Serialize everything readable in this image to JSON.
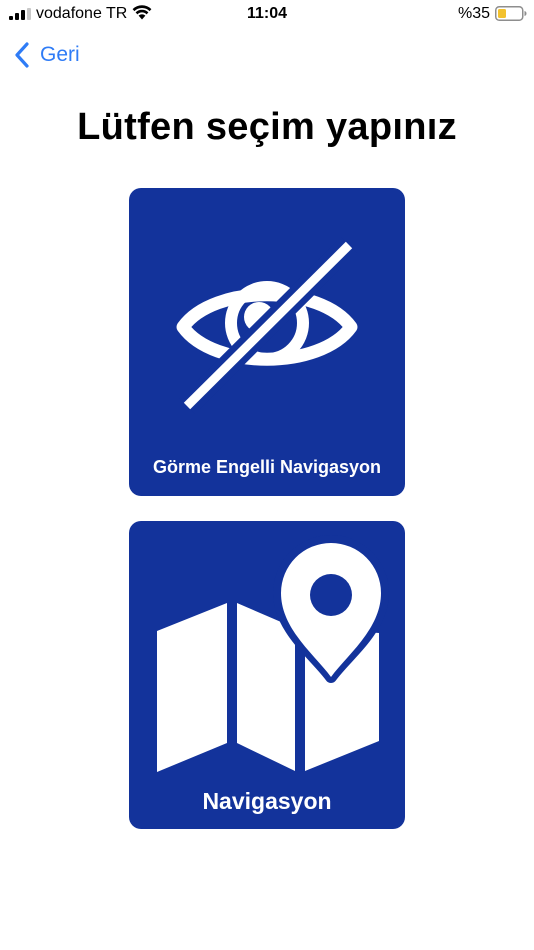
{
  "status_bar": {
    "carrier": "vodafone TR",
    "time": "11:04",
    "battery_percent": "%35",
    "battery_level": 0.35,
    "icons": [
      "signal-icon",
      "wifi-icon",
      "battery-icon"
    ]
  },
  "nav": {
    "back_label": "Geri",
    "back_icon": "chevron-left-icon"
  },
  "page": {
    "title": "Lütfen seçim yapınız"
  },
  "options": [
    {
      "label": "Görme Engelli Navigasyon",
      "icon": "eye-slash-icon"
    },
    {
      "label": "Navigasyon",
      "icon": "map-pin-icon"
    }
  ],
  "colors": {
    "accent": "#2f7cf6",
    "card_background": "#13339b",
    "card_foreground": "#ffffff",
    "battery_fill": "#f2c12e"
  }
}
